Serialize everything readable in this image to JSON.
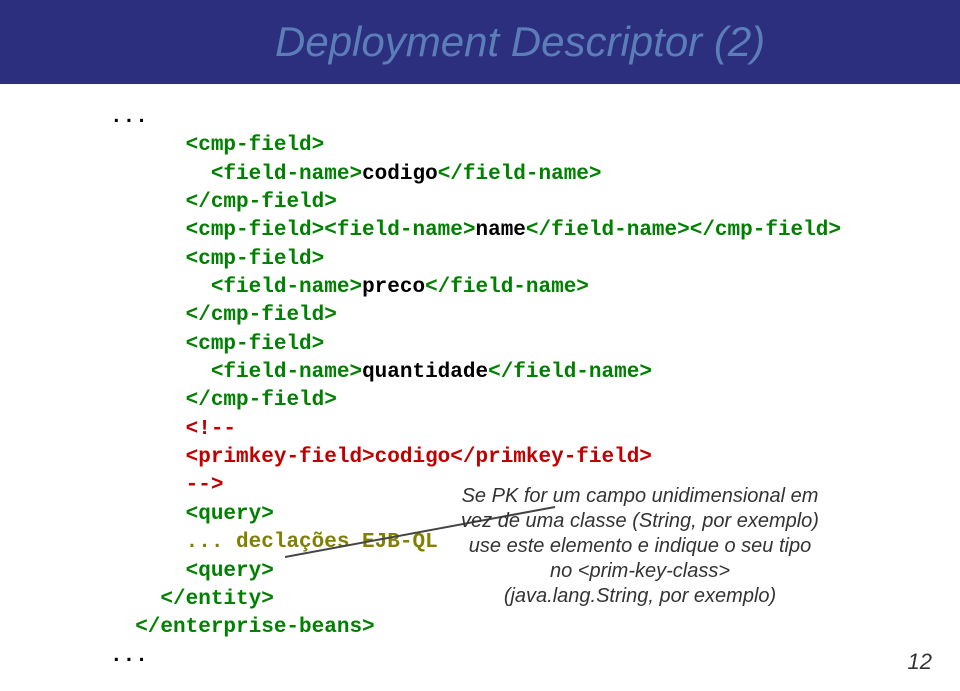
{
  "header": {
    "title": "Deployment Descriptor (2)"
  },
  "code": {
    "l1": "...",
    "l2a": "<cmp-field>",
    "l3a": "  <field-name>",
    "l3b": "codigo",
    "l3c": "</field-name>",
    "l4a": "</cmp-field>",
    "l5a": "<cmp-field><field-name>",
    "l5b": "name",
    "l5c": "</field-name></cmp-field>",
    "l6a": "<cmp-field>",
    "l7a": "  <field-name>",
    "l7b": "preco",
    "l7c": "</field-name>",
    "l8a": "</cmp-field>",
    "l9a": "<cmp-field>",
    "l10a": "  <field-name>",
    "l10b": "quantidade",
    "l10c": "</field-name>",
    "l11a": "</cmp-field>",
    "l12a": "<!--",
    "l13a": "<primkey-field>",
    "l13b": "codigo",
    "l13c": "</primkey-field>",
    "l14a": "-->",
    "l15a": "<query>",
    "l16a": "... declações EJB-QL",
    "l17a": "<query>",
    "l18a": "    </entity>",
    "l19a": "  </enterprise-beans>",
    "l20a": "..."
  },
  "callout": {
    "l1": "Se PK for um campo unidimensional em",
    "l2": "vez de uma classe (String, por exemplo)",
    "l3": "use este elemento e indique o seu tipo",
    "l4": "no <prim-key-class>",
    "l5": "(java.lang.String, por exemplo)"
  },
  "page": "12"
}
